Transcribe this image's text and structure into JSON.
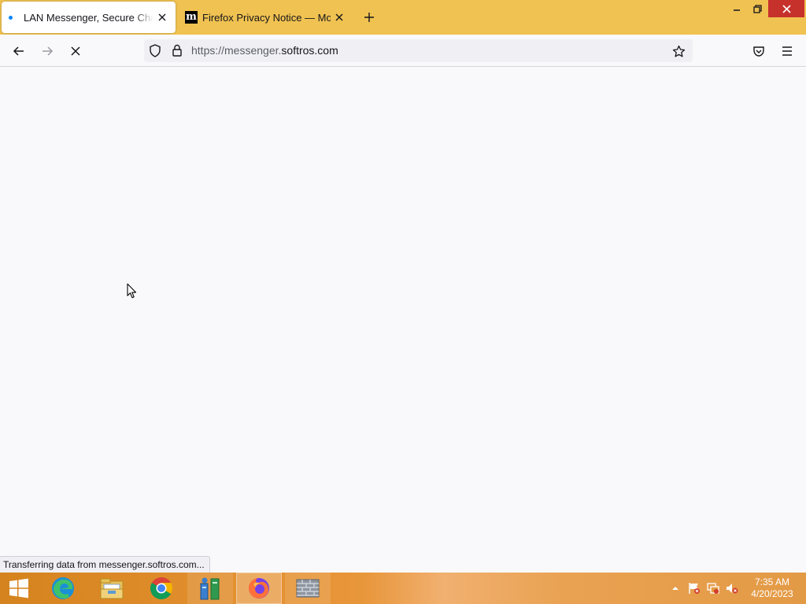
{
  "browser": {
    "tabs": [
      {
        "title": "LAN Messenger, Secure Chat - LAN",
        "state": "loading",
        "active": true
      },
      {
        "title": "Firefox Privacy Notice — Mozilla",
        "favicon": "m",
        "active": false
      }
    ],
    "url": {
      "prefix": "https://messenger.",
      "host": "softros.com"
    },
    "status_text": "Transferring data from messenger.softros.com...",
    "accent_color": "#f0c251"
  },
  "taskbar": {
    "apps": [
      "start-icon",
      "edge-icon",
      "file-explorer-icon",
      "chrome-icon",
      "network-app-icon",
      "firefox-icon",
      "firewall-icon"
    ],
    "clock": {
      "time": "7:35 AM",
      "date": "4/20/2023"
    }
  }
}
